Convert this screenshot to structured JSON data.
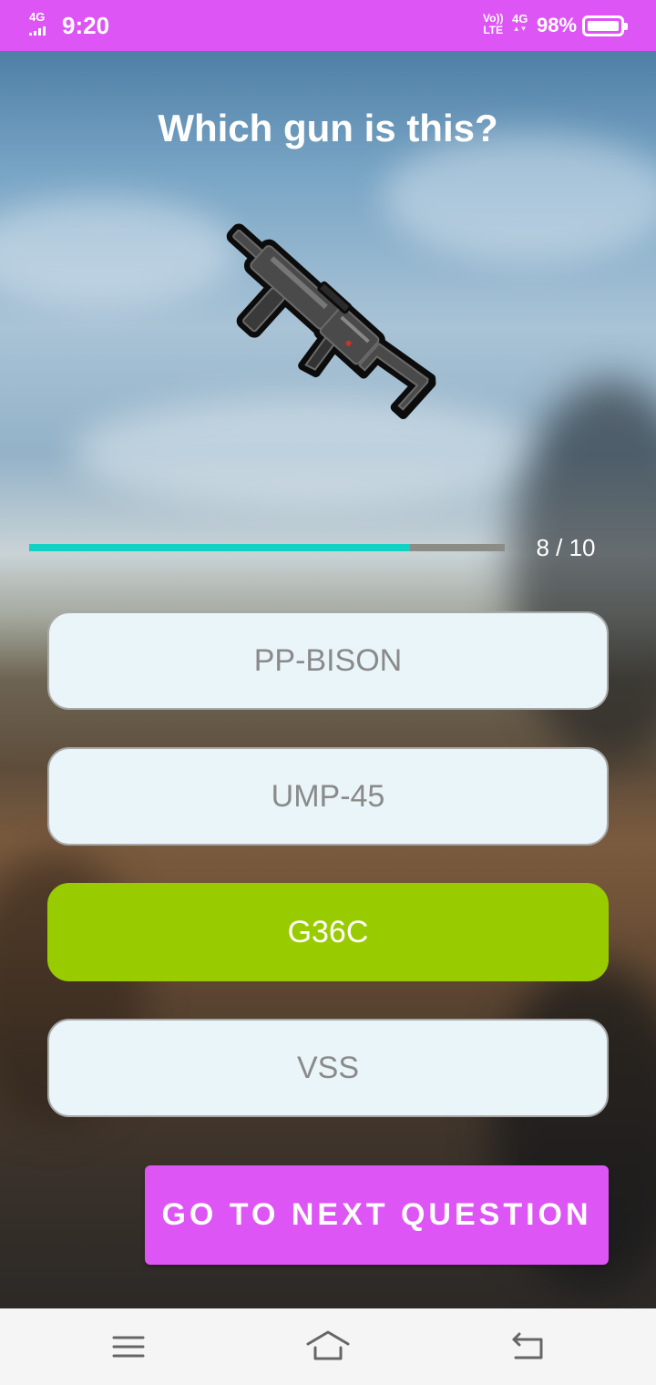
{
  "status_bar": {
    "network_small": "4G",
    "time": "9:20",
    "volte_top": "Vo))",
    "volte_bottom": "LTE",
    "data_type": "4G",
    "battery_percent": "98%"
  },
  "quiz": {
    "question": "Which gun is this?",
    "progress_text": "8 / 10",
    "progress_fraction": 0.8,
    "options": [
      {
        "label": "PP-BISON",
        "state": "default"
      },
      {
        "label": "UMP-45",
        "state": "default"
      },
      {
        "label": "G36C",
        "state": "correct"
      },
      {
        "label": "VSS",
        "state": "default"
      }
    ],
    "next_button": "GO TO NEXT QUESTION"
  },
  "colors": {
    "accent": "#dd55f5",
    "correct": "#99cc00",
    "progress": "#11d0c4",
    "option_bg": "#eaf5f9"
  },
  "nav_bar": {
    "icons": [
      "menu-icon",
      "home-icon",
      "back-icon"
    ]
  }
}
